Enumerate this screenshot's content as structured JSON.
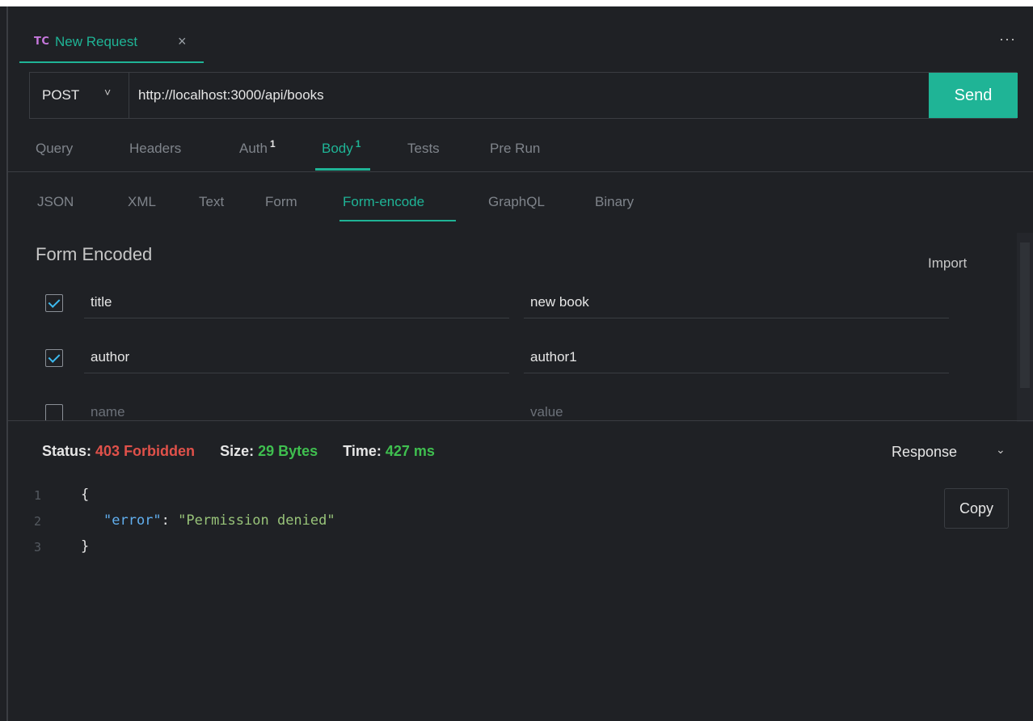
{
  "tab": {
    "icon_text": "TC",
    "title": "New Request",
    "close": "×"
  },
  "more_menu": "···",
  "request": {
    "method": "POST",
    "url": "http://localhost:3000/api/books",
    "send_label": "Send"
  },
  "request_tabs": [
    {
      "label": "Query",
      "badge": ""
    },
    {
      "label": "Headers",
      "badge": ""
    },
    {
      "label": "Auth",
      "badge": "1"
    },
    {
      "label": "Body",
      "badge": "1",
      "active": true
    },
    {
      "label": "Tests",
      "badge": ""
    },
    {
      "label": "Pre Run",
      "badge": ""
    }
  ],
  "body_tabs": [
    "JSON",
    "XML",
    "Text",
    "Form",
    "Form-encode",
    "GraphQL",
    "Binary"
  ],
  "body_active": "Form-encode",
  "form": {
    "title": "Form Encoded",
    "import_label": "Import",
    "rows": [
      {
        "checked": true,
        "name": "title",
        "value": "new book"
      },
      {
        "checked": true,
        "name": "author",
        "value": "author1"
      }
    ],
    "placeholder_name": "name",
    "placeholder_value": "value"
  },
  "response": {
    "status_label": "Status:",
    "status_value": "403 Forbidden",
    "size_label": "Size:",
    "size_value": "29 Bytes",
    "time_label": "Time:",
    "time_value": "427 ms",
    "view_select": "Response",
    "copy_label": "Copy",
    "line_numbers": [
      "1",
      "2",
      "3"
    ],
    "lines": {
      "open": "{",
      "key": "\"error\"",
      "colon": ": ",
      "value": "\"Permission denied\"",
      "close": "}"
    }
  },
  "colors": {
    "accent": "#1fb496",
    "error": "#e0514a",
    "success": "#3fbf4f",
    "background": "#1f2125"
  }
}
